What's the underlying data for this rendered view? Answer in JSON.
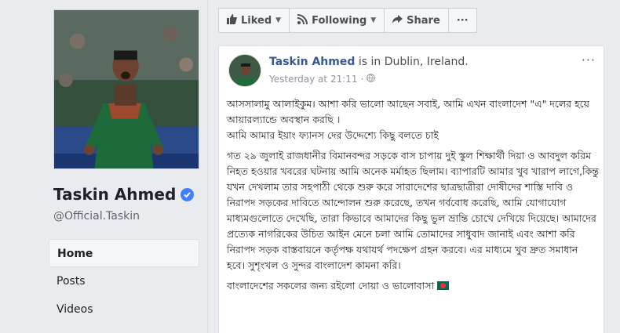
{
  "profile": {
    "name": "Taskin Ahmed",
    "handle": "@Official.Taskin",
    "nav": [
      "Home",
      "Posts",
      "Videos"
    ],
    "active_nav": "Home"
  },
  "actions": {
    "liked": "Liked",
    "following": "Following",
    "share": "Share",
    "more": "···"
  },
  "post": {
    "author": "Taskin Ahmed",
    "location_text": " is in Dublin, Ireland.",
    "time": "Yesterday at 21:11",
    "menu": "···",
    "paragraph1_line1": "আসসালামু আলাইকুম। আশা করি ভালো আছেন সবাই, আমি এখন বাংলাদেশ \"এ\" দলের হয়ে আয়ারল্যান্ডে অবস্থান করছি ।",
    "paragraph1_line2": "আমি আমার ইয়াং ফ্যানস দের উদ্দেশ্যে কিছু বলতে চাই",
    "paragraph2": "গত ২৯ জুলাই রাজধানীর বিমানবন্দর সড়কে বাস চাপায় দুই স্কুল শিক্ষার্থী দিয়া ও আবদুল করিম নিহত হওয়ার খবরের ঘটনায় আমি অনেক মর্মাহত ছিলাম। ব্যাপারটি আমার খুব খারাপ লাগে,কিন্তু যখন দেখলাম তার সহপাঠী থেকে শুরু করে সারাদেশের ছাত্রছাত্রীরা দোষীদের শাস্তি দাবি ও নিরাপদ সড়কের দাবিতে আন্দোলন শুরু করেছে, তখন গর্ববোধ করেছি, আমি যোগাযোগ মাধ্যমগুলোতে দেখেছি, তারা কিভাবে আমাদের কিছু ভুল ভ্রান্তি চোখে দেখিয়ে দিয়েছে। আমাদের প্রত্যেক নাগরিকের উচিত আইন মেনে চলা আমি তোমাদের সাধুবাদ জানাই এবং আশা করি নিরাপদ সড়ক বাস্তবায়নে কর্তৃপক্ষ যথাযর্থ পদক্ষেপ গ্রহন করবে। এর মাধ্যমে খুব দ্রুত সমাধান হবে। সুশৃংখল ও সুন্দর বাংলাদেশ কামনা করি।",
    "paragraph3": "বাংলাদেশের সকলের জন্য রইলো দোয়া ও ভালোবাসা"
  },
  "colors": {
    "link": "#365899",
    "verified": "#4080ff",
    "jersey": "#1e6b3a",
    "flag_green": "#006a4e",
    "flag_red": "#f42a41"
  }
}
